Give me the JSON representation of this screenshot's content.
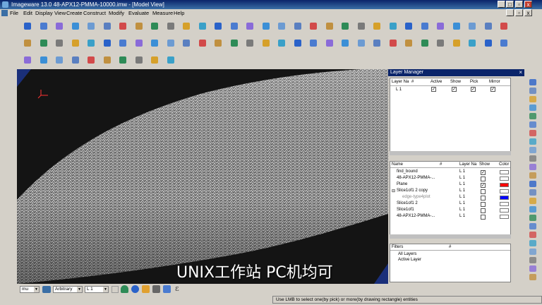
{
  "window": {
    "title": "Imageware 13.0   48-APX12-PMMA-10000.imw - [Model View]"
  },
  "menu": [
    "File",
    "Edit",
    "Display",
    "View",
    "Create",
    "Construct",
    "Modify",
    "Evaluate",
    "Measure",
    "Help"
  ],
  "subtitle": "UNIX工作站 PC机均可",
  "layer_manager": {
    "title": "Layer Manager",
    "layers_header": {
      "name": "Layer Na",
      "num": "#",
      "active": "Active",
      "show": "Show",
      "pick": "Pick",
      "mirror": "Mirror"
    },
    "layers": [
      {
        "name": "L 1",
        "active": true,
        "show": true,
        "pick": true,
        "mirror": true
      }
    ],
    "entities_header": {
      "name": "Name",
      "num": "#",
      "layer": "Layer Na",
      "show": "Show",
      "color": "Color"
    },
    "entities": [
      {
        "name": "find_bound",
        "layer": "L 1",
        "show": true,
        "color": "#ffffff"
      },
      {
        "name": "48-APX12-PMMA-...",
        "layer": "L 1",
        "show": false,
        "color": "#ffffff"
      },
      {
        "name": "Plane",
        "layer": "L 1",
        "show": true,
        "color": "#ff0000"
      },
      {
        "name": "Slice1of1 2 copy",
        "layer": "L 1",
        "show": false,
        "color": "#ffffff"
      },
      {
        "name": "edge-type4plot",
        "layer": "L 1",
        "show": false,
        "color": "#0000ff"
      },
      {
        "name": "Slice1of1 2",
        "layer": "L 1",
        "show": false,
        "color": "#ffffff"
      },
      {
        "name": "Slice1of1",
        "layer": "L 1",
        "show": false,
        "color": "#ffffff"
      },
      {
        "name": "48-APX12-PMMA-...",
        "layer": "L 1",
        "show": false,
        "color": "#ffffff"
      }
    ],
    "filters_header": "Filters",
    "filters_num": "#",
    "filters": [
      "All Layers",
      "Active Layer"
    ]
  },
  "bottom": {
    "units": "mu",
    "view_mode": "Arbitrary",
    "layer": "L 1",
    "status_text": "Use LMB to select one(by pick) or more(by drawing rectangle) entities"
  }
}
